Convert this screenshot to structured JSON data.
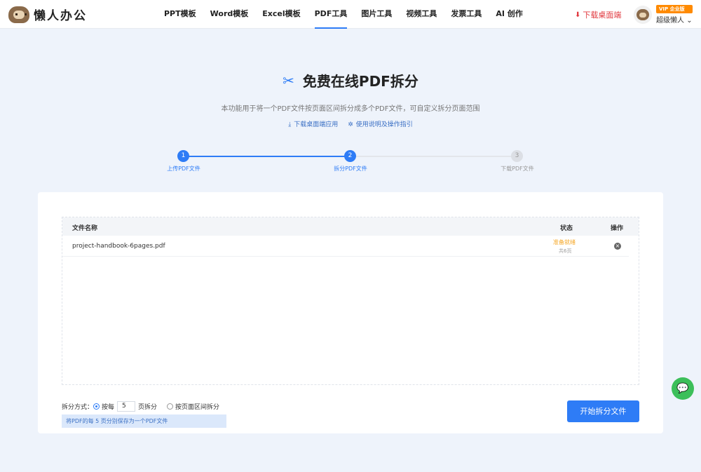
{
  "header": {
    "logo_text": "懒人办公",
    "nav": [
      "PPT模板",
      "Word模板",
      "Excel模板",
      "PDF工具",
      "图片工具",
      "视频工具",
      "发票工具",
      "AI 创作"
    ],
    "active_nav": "PDF工具",
    "download_desktop": "下载桌面端",
    "vip_badge": "VIP 企业版",
    "username": "超级懒人"
  },
  "hero": {
    "title": "免费在线PDF拆分",
    "subtitle": "本功能用于将一个PDF文件按页面区间拆分成多个PDF文件，可自定义拆分页面范围",
    "link_download": "下载桌面端应用",
    "link_guide": "使用说明及操作指引"
  },
  "steps": [
    {
      "num": "1",
      "label": "上传PDF文件",
      "state": "done"
    },
    {
      "num": "2",
      "label": "拆分PDF文件",
      "state": "current"
    },
    {
      "num": "3",
      "label": "下载PDF文件",
      "state": "pending"
    }
  ],
  "table": {
    "col_name": "文件名称",
    "col_status": "状态",
    "col_op": "操作",
    "rows": [
      {
        "name": "project-handbook-6pages.pdf",
        "status": "准备就绪",
        "pages": "共6页"
      }
    ]
  },
  "split": {
    "label": "拆分方式：",
    "opt1_prefix": "按每",
    "opt1_value": "5",
    "opt1_suffix": "页拆分",
    "opt2": "按页面区间拆分",
    "hint": "将PDF的每 5 页分别保存为一个PDF文件",
    "start_button": "开始拆分文件"
  },
  "colors": {
    "accent": "#2e7cf6",
    "ready": "#f5a623",
    "danger": "#e0383e",
    "wechat": "#3cbf5a"
  }
}
